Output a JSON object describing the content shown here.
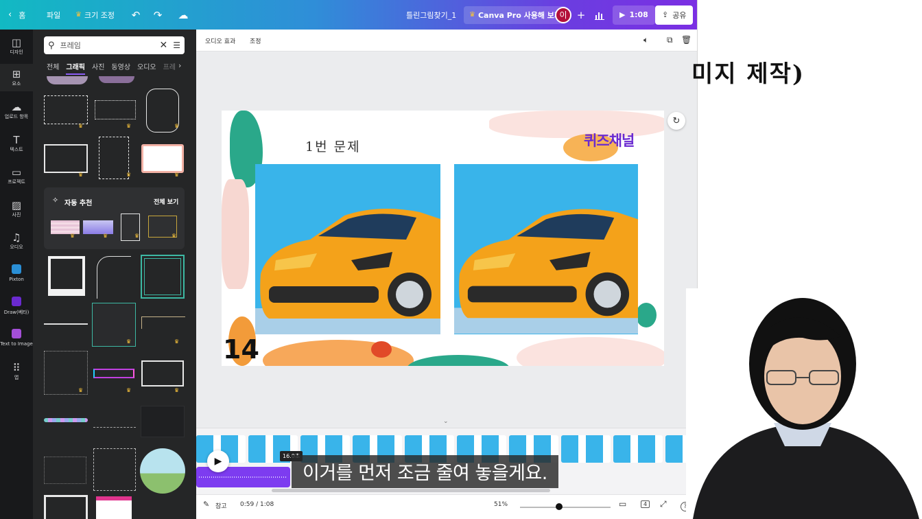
{
  "topbar": {
    "home_label": "홈",
    "file_label": "파일",
    "resize_label": "크기 조정",
    "doc_title": "틀린그림찾기_1",
    "pro_label": "Canva Pro 사용해 보기",
    "avatar_initial": "이",
    "play_time": "1:08",
    "share_label": "공유"
  },
  "rail": {
    "items": [
      {
        "label": "디자인",
        "icon": "layout-icon"
      },
      {
        "label": "요소",
        "icon": "shapes-icon"
      },
      {
        "label": "업로드 항목",
        "icon": "cloud-upload-icon"
      },
      {
        "label": "텍스트",
        "icon": "text-icon"
      },
      {
        "label": "프로젝트",
        "icon": "folder-icon"
      },
      {
        "label": "사진",
        "icon": "image-icon"
      },
      {
        "label": "오디오",
        "icon": "music-icon"
      },
      {
        "label": "Pixton",
        "icon": "pixton-icon"
      },
      {
        "label": "Draw(베타)",
        "icon": "draw-icon"
      },
      {
        "label": "Text to Image",
        "icon": "text-to-image-icon"
      },
      {
        "label": "앱",
        "icon": "apps-grid-icon"
      }
    ]
  },
  "panel": {
    "search_value": "프레임",
    "tabs": [
      "전체",
      "그래픽",
      "사진",
      "동영상",
      "오디오",
      "프레"
    ],
    "active_tab": "그래픽",
    "reco_title": "자동 추천",
    "reco_all": "전체 보기"
  },
  "editor": {
    "toolbar_audio_effects": "오디오 효과",
    "toolbar_adjust": "조정",
    "slide_title": "1번 문제",
    "channel_name": "퀴즈채널",
    "slide_number": "14"
  },
  "timeline": {
    "time_chip": "16.0초",
    "subtitle": "이거를 먼저 조금 줄여 놓을게요."
  },
  "bottombar": {
    "notes_label": "참고",
    "time_display": "0:59 / 1:08",
    "zoom": "51%",
    "page_count": "4",
    "help": "?"
  },
  "background": {
    "heading_fragment": "미지 제작)"
  },
  "colors": {
    "accent": "#7d3cf0",
    "panel_bg": "#252627",
    "rail_bg": "#18191b",
    "crown": "#f7c23b",
    "channel": "#6a2ad0"
  }
}
